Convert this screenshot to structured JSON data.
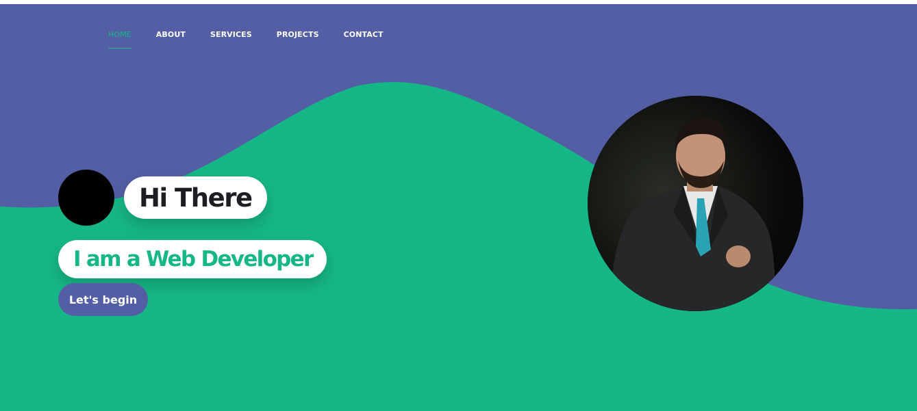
{
  "nav": {
    "items": [
      {
        "label": "HOME",
        "active": true
      },
      {
        "label": "ABOUT"
      },
      {
        "label": "SERVICES"
      },
      {
        "label": "PROJECTS"
      },
      {
        "label": "CONTACT"
      }
    ]
  },
  "hero": {
    "greeting": "Hi There",
    "role": "I am a Web Developer",
    "cta_label": "Let's begin",
    "avatar_icon": "black-circle-avatar",
    "portrait_icon": "profile-photo"
  },
  "colors": {
    "primary_purple": "#535ea5",
    "accent_green": "#16b786",
    "white": "#ffffff",
    "dark_text": "#1d1d22"
  }
}
